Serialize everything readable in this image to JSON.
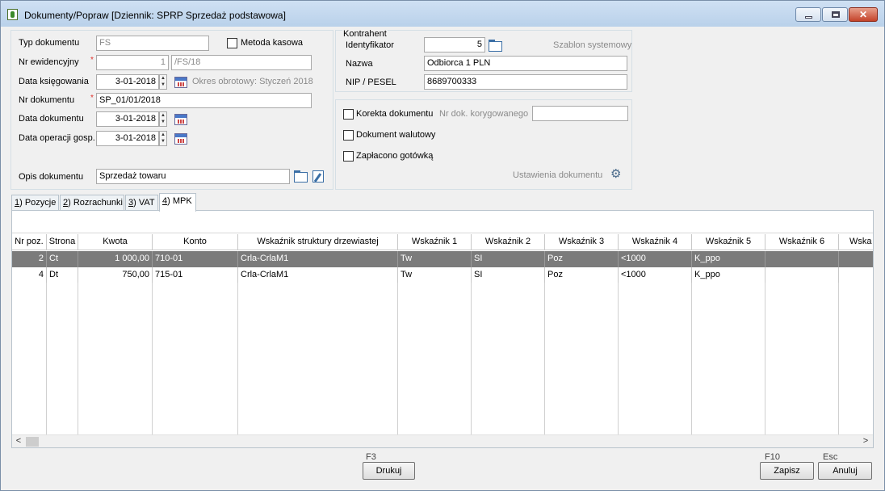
{
  "window": {
    "title": "Dokumenty/Popraw [Dziennik: SPRP  Sprzedaż podstawowa]",
    "minimize_icon": "minimize-icon",
    "maximize_icon": "maximize-icon",
    "close_icon": "close-icon",
    "close_glyph": "✕"
  },
  "document": {
    "typ_label": "Typ dokumentu",
    "typ_value": "FS",
    "metoda_kasowa_label": "Metoda kasowa",
    "nr_ewid_label": "Nr ewidencyjny",
    "nr_ewid_value": "1",
    "nr_ewid_suffix": "/FS/18",
    "data_ksieg_label": "Data księgowania",
    "data_ksieg_value": "3-01-2018",
    "okres_text": "Okres obrotowy: Styczeń 2018",
    "nr_dok_label": "Nr dokumentu",
    "nr_dok_value": "SP_01/01/2018",
    "data_dok_label": "Data dokumentu",
    "data_dok_value": "3-01-2018",
    "data_oper_label": "Data operacji gosp.",
    "data_oper_value": "3-01-2018",
    "opis_label": "Opis dokumentu",
    "opis_value": "Sprzedaż towaru",
    "required_mark": "*"
  },
  "kontrahent": {
    "group_label": "Kontrahent",
    "identyfikator_label": "Identyfikator",
    "identyfikator_value": "5",
    "szablon_text": "Szablon systemowy",
    "nazwa_label": "Nazwa",
    "nazwa_value": "Odbiorca 1 PLN",
    "nip_label": "NIP / PESEL",
    "nip_value": "8689700333"
  },
  "options": {
    "korekta_label": "Korekta dokumentu",
    "nr_korygowanego_label": "Nr dok. korygowanego",
    "walutowy_label": "Dokument walutowy",
    "zaplacono_label": "Zapłacono gotówką",
    "ustawienia_label": "Ustawienia dokumentu",
    "gear_icon": "gear-icon"
  },
  "tabs": [
    {
      "key": "1",
      "label": ") Pozycje"
    },
    {
      "key": "2",
      "label": ") Rozrachunki"
    },
    {
      "key": "3",
      "label": ") VAT"
    },
    {
      "key": "4",
      "label": ") MPK"
    }
  ],
  "table": {
    "columns": [
      "Nr poz.",
      "Strona",
      "Kwota",
      "Konto",
      "Wskaźnik struktury drzewiastej",
      "Wskaźnik 1",
      "Wskaźnik 2",
      "Wskaźnik 3",
      "Wskaźnik 4",
      "Wskaźnik 5",
      "Wskaźnik 6",
      "Wska"
    ],
    "rows": [
      [
        "2",
        "Ct",
        "1 000,00",
        "710-01",
        "Crla-CrlaM1",
        "Tw",
        "SI",
        "Poz",
        "<1000",
        "K_ppo",
        "",
        ""
      ],
      [
        "4",
        "Dt",
        "750,00",
        "715-01",
        "Crla-CrlaM1",
        "Tw",
        "SI",
        "Poz",
        "<1000",
        "K_ppo",
        "",
        ""
      ]
    ],
    "selected_row": 0,
    "scroll_left": "<",
    "scroll_right": ">"
  },
  "footer": {
    "drukuj_key": "F3",
    "drukuj_label": "Drukuj",
    "zapisz_key": "F10",
    "zapisz_label": "Zapisz",
    "anuluj_key": "Esc",
    "anuluj_label": "Anuluj"
  }
}
